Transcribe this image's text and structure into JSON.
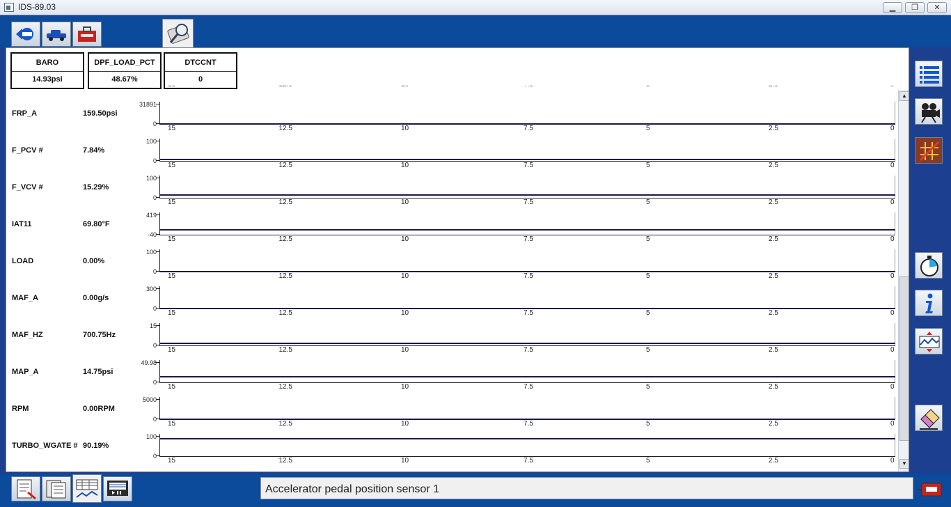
{
  "window": {
    "title": "IDS-89.03",
    "minimize_label": "▁",
    "restore_label": "❐",
    "close_label": "✕"
  },
  "toolbar": {
    "buttons": [
      {
        "icon": "back-arrow-icon"
      },
      {
        "icon": "vehicle-icon"
      },
      {
        "icon": "toolbox-icon"
      },
      {
        "icon": "datalogger-icon"
      }
    ]
  },
  "summary": [
    {
      "label": "BARO",
      "value": "14.93psi"
    },
    {
      "label": "DPF_LOAD_PCT",
      "value": "48.67%"
    },
    {
      "label": "DTCCNT",
      "value": "0"
    }
  ],
  "x_ticks": [
    "15",
    "12.5",
    "10",
    "7.5",
    "5",
    "2.5",
    "0"
  ],
  "pids": [
    {
      "name": "FRP_A",
      "value": "159.50psi",
      "ymax": "31891",
      "ymin": "0",
      "level": 0.0
    },
    {
      "name": "F_PCV #",
      "value": "7.84%",
      "ymax": "100",
      "ymin": "0",
      "level": 0.08
    },
    {
      "name": "F_VCV #",
      "value": "15.29%",
      "ymax": "100",
      "ymin": "0",
      "level": 0.15
    },
    {
      "name": "IAT11",
      "value": "69.80°F",
      "ymax": "419",
      "ymin": "-40",
      "level": 0.24
    },
    {
      "name": "LOAD",
      "value": "0.00%",
      "ymax": "100",
      "ymin": "0",
      "level": 0.0
    },
    {
      "name": "MAF_A",
      "value": "0.00g/s",
      "ymax": "300",
      "ymin": "0",
      "level": 0.0
    },
    {
      "name": "MAF_HZ",
      "value": "700.75Hz",
      "ymax": "15",
      "ymin": "0",
      "level": 0.1
    },
    {
      "name": "MAP_A",
      "value": "14.75psi",
      "ymax": "49.98",
      "ymin": "0",
      "level": 0.3
    },
    {
      "name": "RPM",
      "value": "0.00RPM",
      "ymax": "5000",
      "ymin": "0",
      "level": 0.0
    },
    {
      "name": "TURBO_WGATE #",
      "value": "90.19%",
      "ymax": "100",
      "ymin": "0",
      "level": 0.9
    }
  ],
  "scrollbar": {
    "up": "▲",
    "down": "▼"
  },
  "right_toolbar": [
    {
      "icon": "list-icon"
    },
    {
      "icon": "movie-camera-icon"
    },
    {
      "icon": "grid-cancel-icon"
    },
    {
      "icon": "stopwatch-icon"
    },
    {
      "icon": "info-icon"
    },
    {
      "icon": "graph-scale-icon"
    },
    {
      "icon": "eraser-icon"
    }
  ],
  "bottom_toolbar": [
    {
      "icon": "report-icon"
    },
    {
      "icon": "pid-list-icon"
    },
    {
      "icon": "graph-view-icon"
    },
    {
      "icon": "playback-icon"
    }
  ],
  "status": {
    "text": "Accelerator pedal position sensor 1"
  },
  "colors": {
    "frame_blue": "#0c4a9b",
    "plot_line": "#1a1a4a",
    "panel_bg": "#ffffff"
  }
}
